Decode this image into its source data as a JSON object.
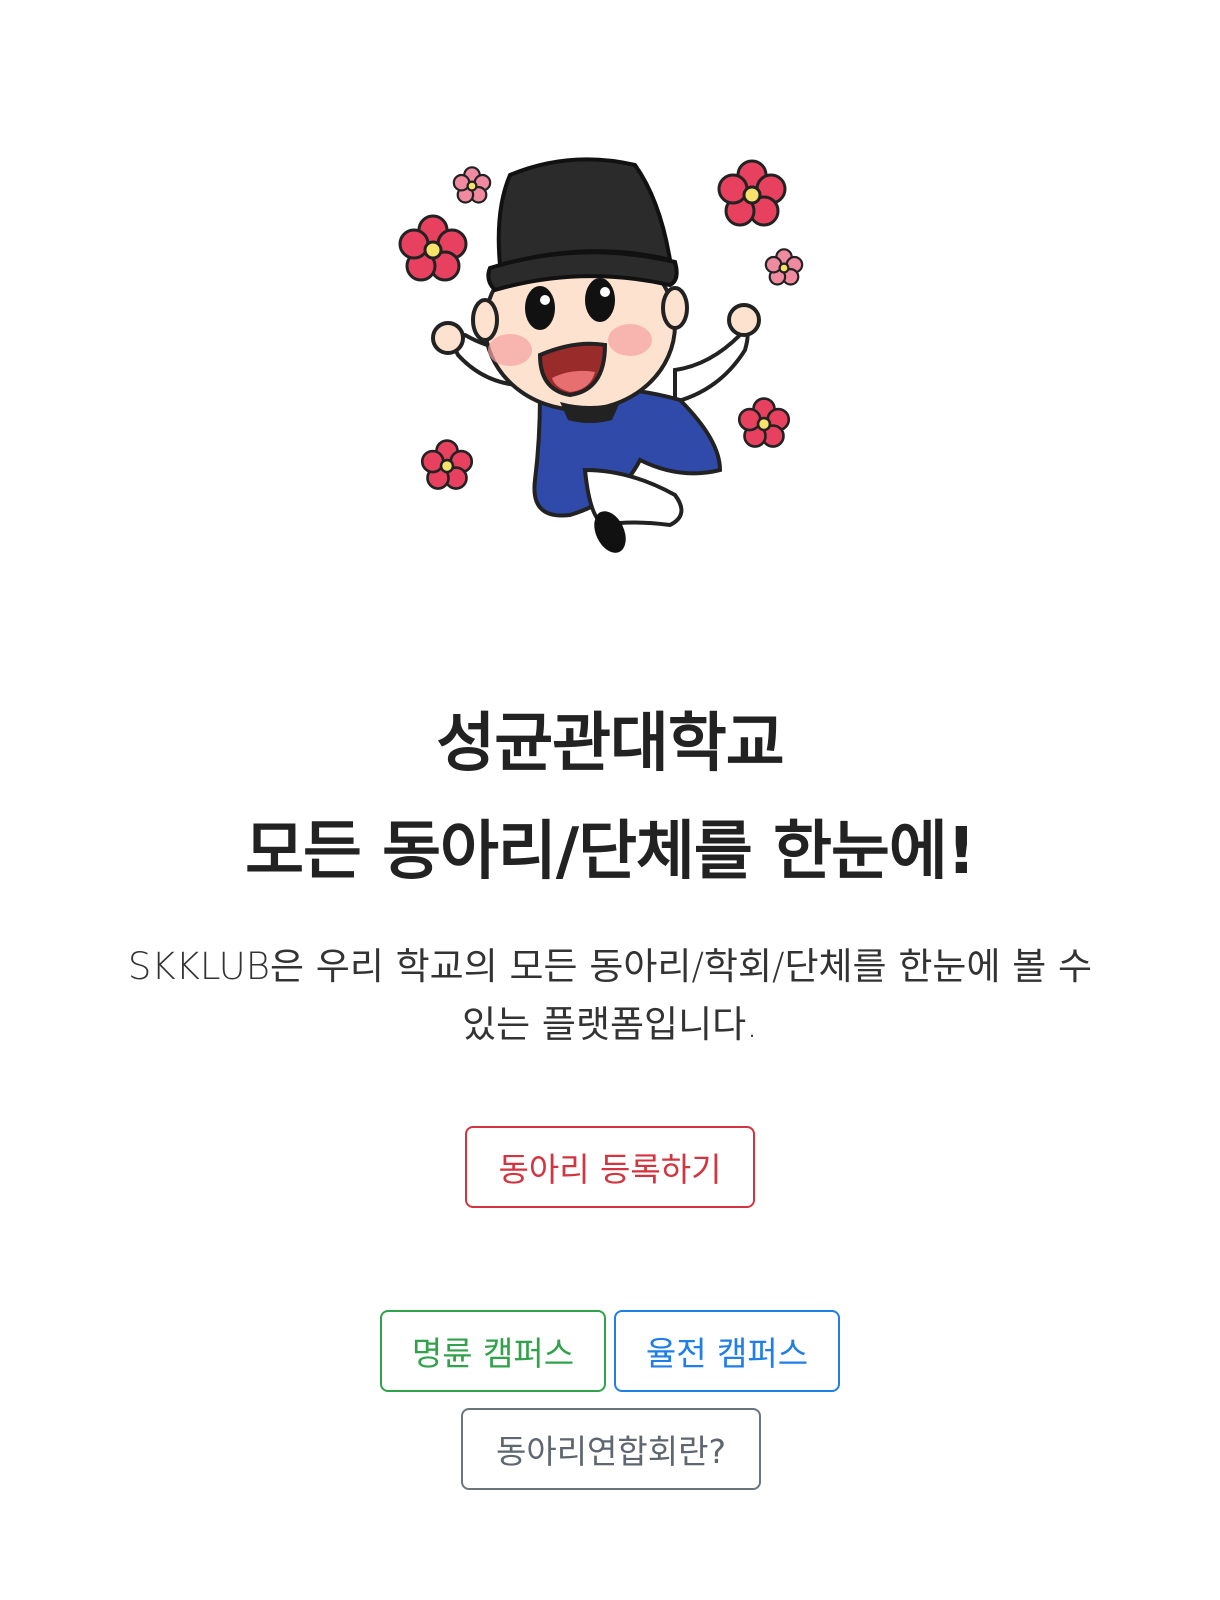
{
  "hero": {
    "image": "mascot-illustration"
  },
  "headline": {
    "line1": "성균관대학교",
    "line2": "모든 동아리/단체를 한눈에!"
  },
  "description": {
    "line1": "SKKLUB은 우리 학교의 모든 동아리/학회/단체를 한눈에 볼 수",
    "line2": "있는 플랫폼입니다."
  },
  "buttons": {
    "register": "동아리 등록하기",
    "myeongnyun": "명륜 캠퍼스",
    "yuljeon": "율전 캠퍼스",
    "union": "동아리연합회란?"
  },
  "colors": {
    "register": "#d2353f",
    "myeongnyun": "#31a24c",
    "yuljeon": "#1f7ee8",
    "union": "#6c757d",
    "flower": "#e8415f",
    "robe": "#2f4aa8"
  }
}
